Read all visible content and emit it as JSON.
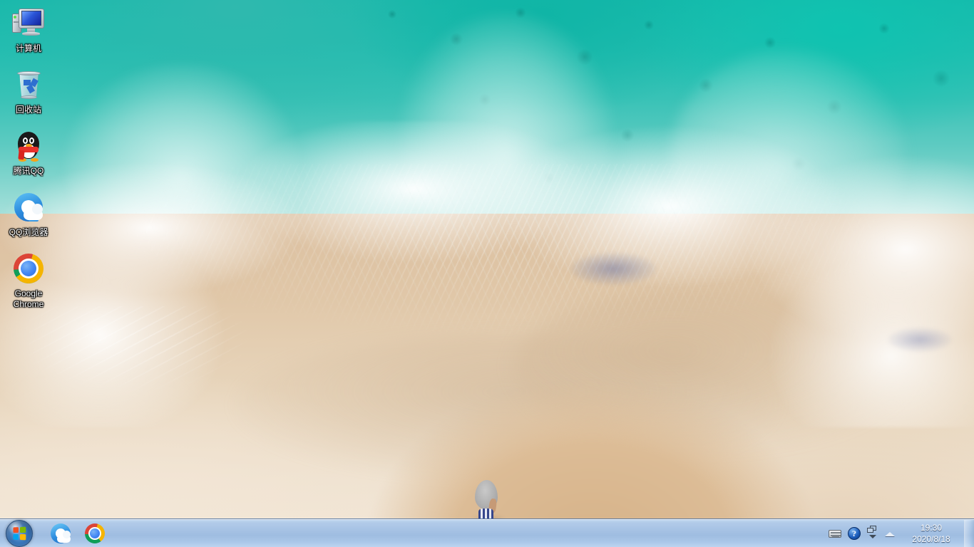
{
  "desktop": {
    "wallpaper_description": "Aerial photo of turquoise ocean waves breaking into white foam over a sandy beach with a person standing on the sand",
    "colors": {
      "ocean_teal": "#17b9ab",
      "ocean_deep": "#0fc3b0",
      "foam_white": "#ffffff",
      "sand_dark": "#d6b288",
      "sand_light": "#f2e7d8",
      "taskbar_blue": "#a6c2e4",
      "start_orb_blue": "#2e6bb0"
    },
    "icons": [
      {
        "id": "computer",
        "label": "计算机",
        "icon": "computer-monitor-icon"
      },
      {
        "id": "recyclebin",
        "label": "回收站",
        "icon": "recycle-bin-icon"
      },
      {
        "id": "tencentqq",
        "label": "腾讯QQ",
        "icon": "qq-penguin-icon"
      },
      {
        "id": "qqbrowser",
        "label": "QQ浏览器",
        "icon": "qq-browser-icon"
      },
      {
        "id": "chrome",
        "label": "Google Chrome",
        "icon": "google-chrome-icon"
      }
    ]
  },
  "taskbar": {
    "start": {
      "label": "开始",
      "icon": "windows-start-orb-icon"
    },
    "pinned": [
      {
        "id": "qqbrowser",
        "label": "QQ浏览器",
        "icon": "qq-browser-icon"
      },
      {
        "id": "chrome",
        "label": "Google Chrome",
        "icon": "google-chrome-icon"
      }
    ],
    "tray": [
      {
        "id": "ime",
        "label": "输入法",
        "icon": "keyboard-ime-icon"
      },
      {
        "id": "help",
        "label": "帮助",
        "icon": "help-question-icon"
      },
      {
        "id": "windows",
        "label": "窗口",
        "icon": "restore-windows-icon"
      },
      {
        "id": "showhidden",
        "label": "显示隐藏的图标",
        "icon": "show-hidden-icons-chevron-up-icon"
      }
    ],
    "clock": {
      "time": "19:30",
      "date": "2020/8/18"
    },
    "show_desktop": {
      "label": "显示桌面"
    }
  }
}
